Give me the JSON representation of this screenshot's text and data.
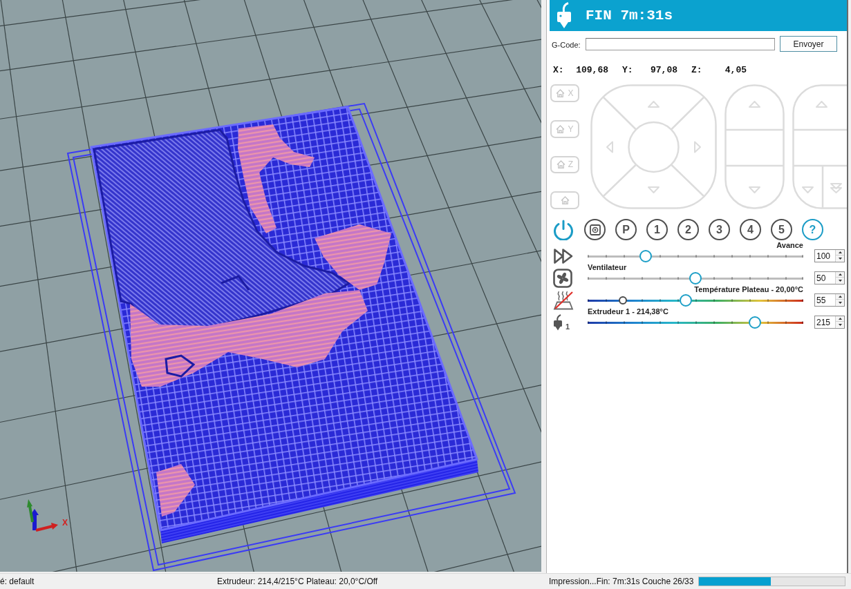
{
  "viewport": {
    "axis_label": "X"
  },
  "header": {
    "title": "FIN 7m:31s"
  },
  "gcode": {
    "label": "G-Code:",
    "button": "Envoyer"
  },
  "position": [
    {
      "axis": "X:",
      "value": "109,68"
    },
    {
      "axis": "Y:",
      "value": "97,08"
    },
    {
      "axis": "Z:",
      "value": "4,05"
    }
  ],
  "jog": {
    "disabled": true,
    "home_buttons": [
      {
        "kind": "axis",
        "label": "X"
      },
      {
        "kind": "axis",
        "label": "Y"
      },
      {
        "kind": "axis",
        "label": "Z"
      },
      {
        "kind": "all"
      }
    ]
  },
  "tool_buttons": [
    {
      "kind": "power",
      "on": true
    },
    {
      "kind": "sd",
      "on": false
    },
    {
      "kind": "text",
      "label": "P",
      "on": false
    },
    {
      "kind": "text",
      "label": "1",
      "on": false
    },
    {
      "kind": "text",
      "label": "2",
      "on": false
    },
    {
      "kind": "text",
      "label": "3",
      "on": false
    },
    {
      "kind": "text",
      "label": "4",
      "on": false
    },
    {
      "kind": "text",
      "label": "5",
      "on": false
    },
    {
      "kind": "text",
      "label": "?",
      "on": true
    }
  ],
  "sliders": [
    {
      "kind": "feedrate",
      "label": "Avance",
      "off": false,
      "level": 0.27,
      "value": "100"
    },
    {
      "kind": "fan",
      "label": "Ventilateur",
      "off": false,
      "level": 0.5,
      "value": "50"
    },
    {
      "kind": "bed",
      "label": "Température Plateau - 20,00°C",
      "off": true,
      "level": 0.455,
      "marker": {
        "level": 0.163
      },
      "value": "55"
    },
    {
      "kind": "extruder",
      "label": "Extrudeur 1 - 214,38°C",
      "off": false,
      "icon_label": "1",
      "level": 0.776,
      "value": "215"
    }
  ],
  "status_bar": {
    "left_text": "é: default",
    "temperatures": "Extrudeur: 214,4/215°C Plateau: 20,0°C/Off",
    "progress_text": "Impression...Fin: 7m:31s Couche 26/33",
    "progress": {
      "level": 0.49
    }
  }
}
